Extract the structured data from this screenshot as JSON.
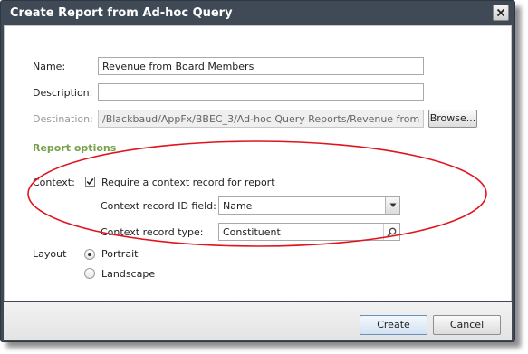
{
  "window": {
    "title": "Create Report from Ad-hoc Query"
  },
  "form": {
    "name_label": "Name:",
    "name_value": "Revenue from Board Members",
    "description_label": "Description:",
    "description_value": "",
    "destination_label": "Destination:",
    "destination_value": "/Blackbaud/AppFx/BBEC_3/Ad-hoc Query Reports/Revenue from Boa",
    "browse_label": "Browse..."
  },
  "report_options": {
    "section_title": "Report options",
    "context_label": "Context:",
    "require_context_label": "Require a context record for report",
    "require_context_checked": true,
    "id_field_label": "Context record ID field:",
    "id_field_value": "Name",
    "record_type_label": "Context record type:",
    "record_type_value": "Constituent"
  },
  "layout": {
    "label": "Layout",
    "portrait_label": "Portrait",
    "landscape_label": "Landscape",
    "selected": "Portrait"
  },
  "buttons": {
    "create": "Create",
    "cancel": "Cancel"
  },
  "icons": {
    "close": "close-icon",
    "checkbox": "checkmark-icon",
    "dropdown": "chevron-down-icon",
    "search": "search-icon"
  },
  "colors": {
    "section_title": "#76a34a",
    "annotation_ellipse": "#e0141e",
    "title_bar": "#3f4a56"
  }
}
